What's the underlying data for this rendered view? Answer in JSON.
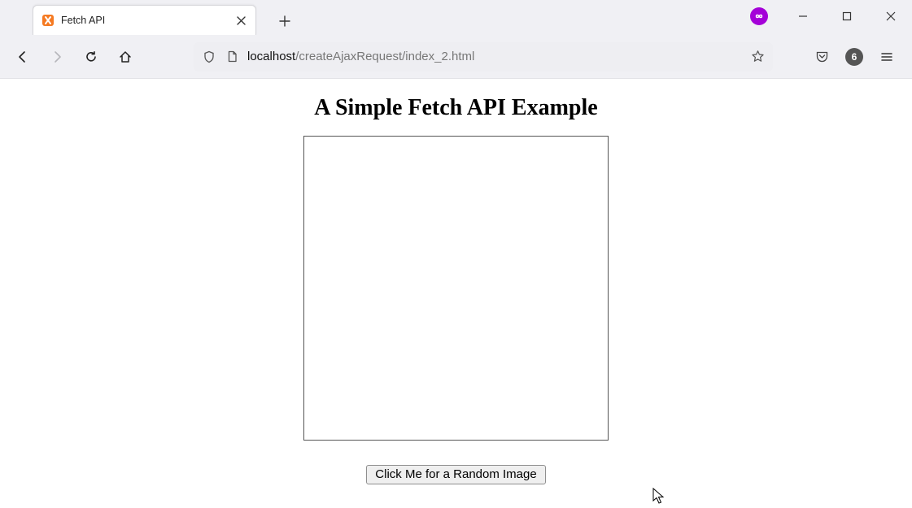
{
  "tab": {
    "title": "Fetch API"
  },
  "urlbar": {
    "host": "localhost",
    "path": "/createAjaxRequest/index_2.html"
  },
  "toolbar": {
    "notification_count": "6"
  },
  "page": {
    "heading": "A Simple Fetch API Example",
    "button_label": "Click Me for a Random Image"
  }
}
